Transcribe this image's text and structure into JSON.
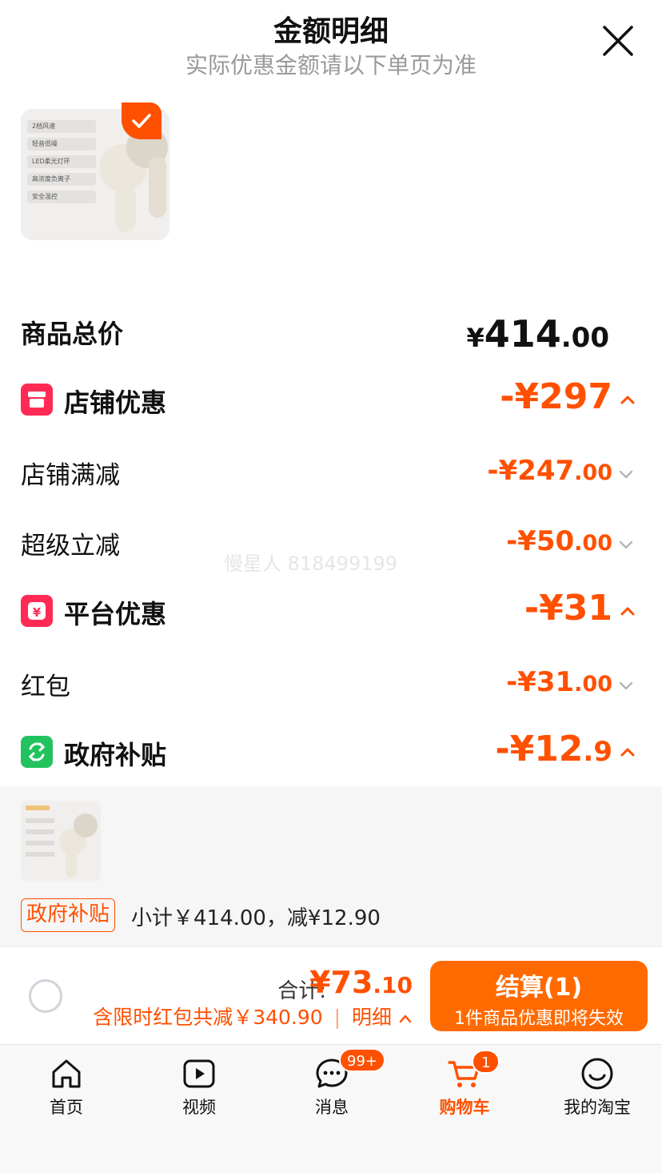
{
  "header": {
    "title": "金额明细",
    "subtitle": "实际优惠金额请以下单页为准"
  },
  "product_thumb": {
    "features": [
      "2档风速",
      "轻音低噪",
      "LED柔光灯环",
      "高浓度负离子",
      "安全温控"
    ]
  },
  "rows": {
    "total": {
      "label": "商品总价",
      "symbol": "¥",
      "int": "414",
      "dec": ".00"
    },
    "shop": {
      "label": "店铺优惠",
      "amount": "-¥297"
    },
    "shop_full_reduce": {
      "label": "店铺满减",
      "int": "-¥247",
      "dec": ".00"
    },
    "super_reduce": {
      "label": "超级立减",
      "int": "-¥50",
      "dec": ".00"
    },
    "platform": {
      "label": "平台优惠",
      "amount": "-¥31"
    },
    "red_packet": {
      "label": "红包",
      "int": "-¥31",
      "dec": ".00"
    },
    "government": {
      "label": "政府补贴",
      "int": "-¥12",
      "dec": ".9"
    }
  },
  "watermark": "慢星人 818499199",
  "gov_section": {
    "tag": "政府补贴",
    "subtotal": "小计￥414.00，减¥12.90"
  },
  "checkout": {
    "total_label": "合计:",
    "total_int": "¥73",
    "total_dec": ".10",
    "discount_text": "含限时红包共减￥340.90",
    "detail_link": "明细",
    "pay_label": "结算(1)",
    "pay_sub": "1件商品优惠即将失效"
  },
  "tabs": [
    {
      "label": "首页",
      "icon": "home-icon"
    },
    {
      "label": "视频",
      "icon": "video-icon"
    },
    {
      "label": "消息",
      "icon": "message-icon",
      "badge": "99+"
    },
    {
      "label": "购物车",
      "icon": "cart-icon",
      "badge": "1",
      "active": true
    },
    {
      "label": "我的淘宝",
      "icon": "smile-icon"
    }
  ],
  "colors": {
    "accent": "#ff5000",
    "shop_icon": "#ff2b55",
    "platform_icon": "#ff2b55",
    "gov_icon": "#22c35e"
  }
}
